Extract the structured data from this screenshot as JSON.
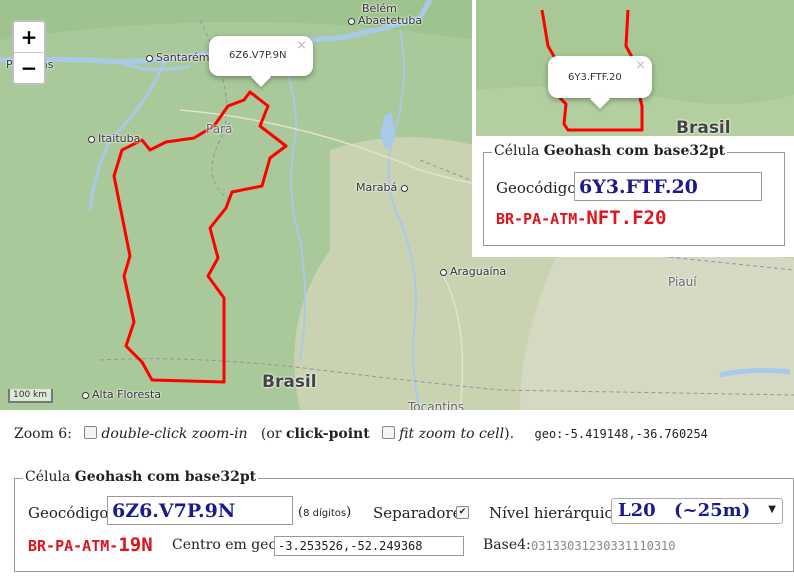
{
  "map": {
    "zoom_in": "+",
    "zoom_out": "−",
    "scale_label": "100 km",
    "places": {
      "belem": "Belém",
      "abaetetuba": "Abaetetuba",
      "santarem": "Santarém",
      "parintins": "Parintins",
      "itaituba": "Itaituba",
      "para": "Pará",
      "maraba": "Marabá",
      "araguaina": "Araguaína",
      "piaui": "Piauí",
      "alta_floresta": "Alta Floresta",
      "brasil": "Brasil",
      "tocantins": "Tocantins"
    },
    "popup_text": "6Z6.V7P.9N",
    "popup_close": "×",
    "region_color": "#ff0000"
  },
  "inset": {
    "popup_text": "6Y3.FTF.20",
    "popup_close": "×",
    "brasil": "Brasil",
    "legend_prefix": "Célula ",
    "legend_bold": "Geohash com base32pt",
    "geocode_label": "Geocódigo:",
    "geocode_value": "6Y3.FTF.20",
    "code_prefix": "BR-PA-ATM-",
    "code_suffix": "NFT.F20"
  },
  "zoom_row": {
    "zoom_label": "Zoom 6:",
    "dblclick_label": "double-click zoom-in",
    "or_text": "(or ",
    "click_point": "click-point",
    "fit_label": "fit zoom to cell",
    "close_paren": ").",
    "geo_text": "geo:-5.419148,-36.760254"
  },
  "cell": {
    "legend_prefix": "Célula ",
    "legend_bold": "Geohash com base32pt",
    "geocode_label": "Geocódigo:",
    "geocode_value": "6Z6.V7P.9N",
    "digits_open": "(",
    "digits": "8 dígitos",
    "digits_close": ")",
    "separators_label": "Separadores",
    "separators_checked": "✔",
    "level_label": "Nível hierárquico:",
    "level_value": "L20",
    "level_size": "(~25m)",
    "code_prefix": "BR-PA-ATM-",
    "code_suffix": "19N",
    "center_label": "Centro em geo:",
    "center_value": "-3.253526,-52.249368",
    "base4_label": "Base4:",
    "base4_value": "03133031230331110310"
  }
}
